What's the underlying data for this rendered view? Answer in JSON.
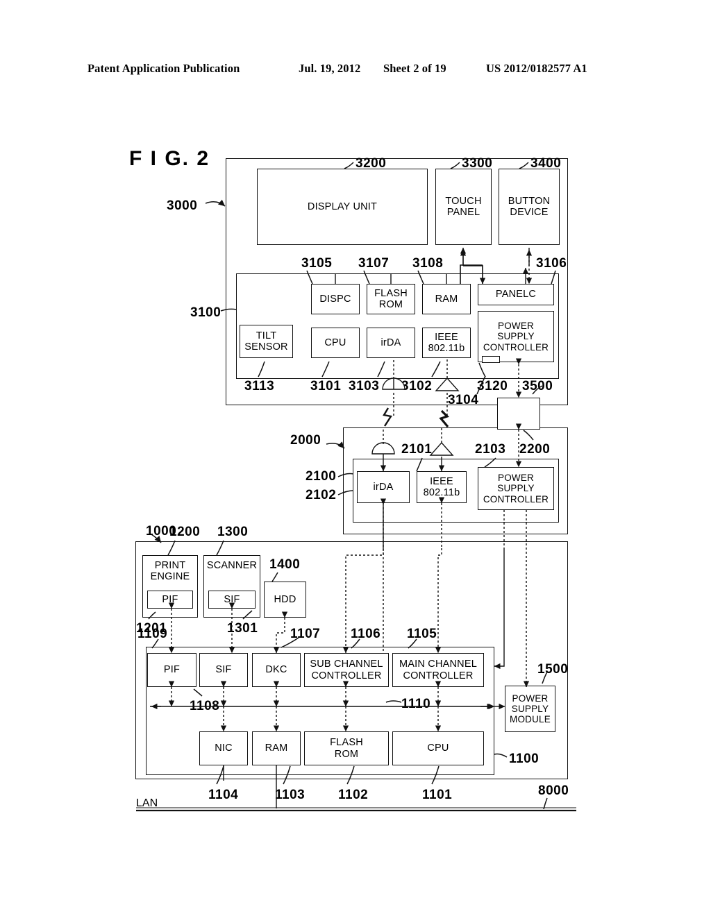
{
  "header": {
    "left": "Patent Application Publication",
    "date": "Jul. 19, 2012",
    "sheet": "Sheet 2 of 19",
    "pubnum": "US 2012/0182577 A1"
  },
  "figure": {
    "label": "F I G.  2"
  },
  "device_3000": {
    "ref": "3000",
    "display_unit": {
      "label": "DISPLAY UNIT",
      "ref": "3200"
    },
    "touch_panel": {
      "label": "TOUCH\nPANEL",
      "line1": "TOUCH",
      "line2": "PANEL",
      "ref": "3300"
    },
    "button_device": {
      "line1": "BUTTON",
      "line2": "DEVICE",
      "ref": "3400"
    },
    "controller_3100": {
      "ref": "3100",
      "top_refs": [
        "3105",
        "3107",
        "3108",
        "3106"
      ],
      "bottom_refs": [
        "3113",
        "3101",
        "3103",
        "3102",
        "3120",
        "3500"
      ],
      "antenna_ref": "3104",
      "blocks": [
        {
          "label": "DISPC",
          "ref": "3105"
        },
        {
          "line1": "FLASH",
          "line2": "ROM",
          "ref": "3107"
        },
        {
          "label": "RAM",
          "ref": "3108"
        },
        {
          "label": "PANELC",
          "ref": "3106"
        },
        {
          "line1": "TILT",
          "line2": "SENSOR",
          "ref": "3113"
        },
        {
          "label": "CPU",
          "ref": "3101"
        },
        {
          "label": "irDA",
          "ref": "3103"
        },
        {
          "line1": "IEEE",
          "line2": "802.11b",
          "ref": "3102"
        },
        {
          "line1": "POWER",
          "line2": "SUPPLY",
          "line3": "CONTROLLER",
          "ref": "3120"
        }
      ]
    }
  },
  "cradle_2000": {
    "ref": "2000",
    "inner_ref": "2100",
    "irda": {
      "label": "irDA",
      "ref": "2102"
    },
    "ieee": {
      "line1": "IEEE",
      "line2": "802.11b",
      "ref": "2101"
    },
    "psc": {
      "line1": "POWER",
      "line2": "SUPPLY",
      "line3": "CONTROLLER",
      "ref": "2103"
    },
    "connector_ref": "2200"
  },
  "mfp_1000": {
    "ref": "1000",
    "print_engine": {
      "line1": "PRINT",
      "line2": "ENGINE",
      "ref": "1200",
      "pif": "PIF",
      "pif_ref": "1201"
    },
    "scanner": {
      "label": "SCANNER",
      "ref": "1300",
      "sif": "SIF",
      "sif_ref": "1301"
    },
    "hdd": {
      "label": "HDD",
      "ref": "1400"
    },
    "controller_1100": {
      "ref": "1100",
      "bus_ref": "1110",
      "row1": [
        {
          "label": "PIF",
          "ref": "1109"
        },
        {
          "label": "SIF",
          "ref": "1108"
        },
        {
          "label": "DKC",
          "ref": "1107"
        },
        {
          "line1": "SUB CHANNEL",
          "line2": "CONTROLLER",
          "ref": "1106"
        },
        {
          "line1": "MAIN CHANNEL",
          "line2": "CONTROLLER",
          "ref": "1105"
        }
      ],
      "row2": [
        {
          "label": "NIC",
          "ref": "1104"
        },
        {
          "label": "RAM",
          "ref": "1103"
        },
        {
          "line1": "FLASH",
          "line2": "ROM",
          "ref": "1102"
        },
        {
          "label": "CPU",
          "ref": "1101"
        }
      ]
    },
    "power_supply_module": {
      "line1": "POWER",
      "line2": "SUPPLY",
      "line3": "MODULE",
      "ref": "1500"
    }
  },
  "network": {
    "lan_label": "LAN",
    "ref": "8000"
  },
  "colors": {
    "ink": "#111111",
    "paper": "#ffffff"
  }
}
